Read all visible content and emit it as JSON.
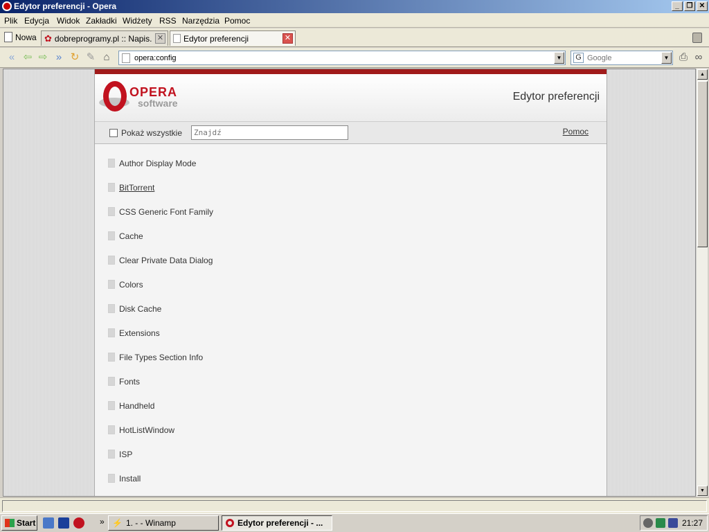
{
  "window": {
    "title": "Edytor preferencji - Opera"
  },
  "menubar": {
    "items": [
      "Plik",
      "Edycja",
      "Widok",
      "Zakładki",
      "Widżety",
      "RSS",
      "Narzędzia",
      "Pomoc"
    ]
  },
  "tabs": {
    "new_label": "Nowa",
    "items": [
      {
        "label": "dobreprogramy.pl :: Napis...",
        "active": false
      },
      {
        "label": "Edytor preferencji",
        "active": true
      }
    ]
  },
  "toolbar": {
    "address": "opera:config",
    "search_placeholder": "Google"
  },
  "page": {
    "logo_brand": "OPERA",
    "logo_sub": "software",
    "title": "Edytor preferencji",
    "show_all_label": "Pokaż wszystkie",
    "find_placeholder": "Znajdź",
    "help_link": "Pomoc",
    "sections": [
      "Author Display Mode",
      "BitTorrent",
      "CSS Generic Font Family",
      "Cache",
      "Clear Private Data Dialog",
      "Colors",
      "Disk Cache",
      "Extensions",
      "File Types Section Info",
      "Fonts",
      "Handheld",
      "HotListWindow",
      "ISP",
      "Install"
    ]
  },
  "taskbar": {
    "start_label": "Start",
    "buttons": [
      {
        "label": "1. - - Winamp",
        "active": false
      },
      {
        "label": "Edytor preferencji - ...",
        "active": true
      }
    ],
    "clock": "21:27"
  },
  "colors": {
    "accent_red": "#a11b1b",
    "title_blue": "#0a246a"
  }
}
